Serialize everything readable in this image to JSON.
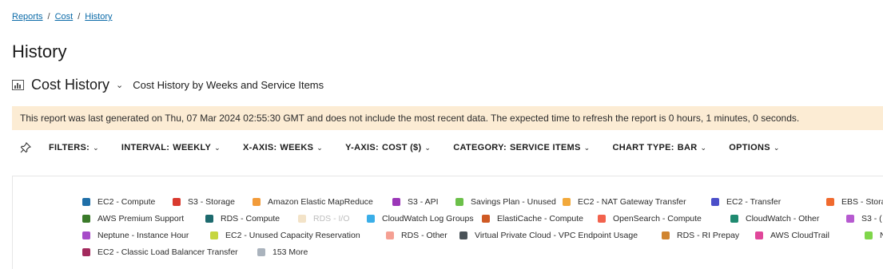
{
  "breadcrumb": {
    "items": [
      "Reports",
      "Cost",
      "History"
    ],
    "separator": "/"
  },
  "page": {
    "title": "History"
  },
  "report": {
    "icon": "bar-chart-icon",
    "name": "Cost History",
    "subtitle": "Cost History by Weeks and Service Items"
  },
  "banner": {
    "text": "This report was last generated on Thu, 07 Mar 2024 02:55:30 GMT and does not include the most recent data.  The expected time to refresh the report is 0 hours, 1 minutes, 0 seconds.",
    "background": "#fcecd4"
  },
  "filters": {
    "pin_icon": "pin-icon",
    "items": [
      {
        "label": "FILTERS:",
        "value": ""
      },
      {
        "label": "INTERVAL:",
        "value": "WEEKLY"
      },
      {
        "label": "X-AXIS:",
        "value": "WEEKS"
      },
      {
        "label": "Y-AXIS:",
        "value": "COST ($)"
      },
      {
        "label": "CATEGORY:",
        "value": "SERVICE ITEMS"
      },
      {
        "label": "CHART TYPE:",
        "value": "BAR"
      },
      {
        "label": "OPTIONS",
        "value": ""
      }
    ]
  },
  "legend": {
    "rows": [
      [
        {
          "label": "EC2 - Compute",
          "color": "#1f6fa8"
        },
        {
          "label": "S3 - Storage",
          "color": "#d93a2f"
        },
        {
          "label": "Amazon Elastic MapReduce",
          "color": "#f29b3a"
        },
        {
          "label": "S3 - API",
          "color": "#9b37b8"
        },
        {
          "label": "Savings Plan - Unused",
          "color": "#6cc04a"
        },
        {
          "label": "EC2 - NAT Gateway Transfer",
          "color": "#f2a93b"
        },
        {
          "label": "EC2 - Transfer",
          "color": "#4b4fc9"
        },
        {
          "label": "EBS - Storage",
          "color": "#f06a2e"
        }
      ],
      [
        {
          "label": "AWS Premium Support",
          "color": "#3a7a2a"
        },
        {
          "label": "RDS - Compute",
          "color": "#1d6a6e"
        },
        {
          "label": "RDS - I/O",
          "color": "#f3e3c8",
          "dim": true
        },
        {
          "label": "CloudWatch Log Groups",
          "color": "#3aaee8"
        },
        {
          "label": "ElastiCache - Compute",
          "color": "#cf5a25"
        },
        {
          "label": "OpenSearch - Compute",
          "color": "#f2624d"
        },
        {
          "label": "CloudWatch - Other",
          "color": "#1f8a70"
        },
        {
          "label": "S3 - (",
          "color": "#b65ad0"
        }
      ],
      [
        {
          "label": "Neptune - Instance Hour",
          "color": "#a64bc8"
        },
        {
          "label": "EC2 - Unused Capacity Reservation",
          "color": "#c6d63f"
        },
        {
          "label": "RDS - Other",
          "color": "#f5a093"
        },
        {
          "label": "Virtual Private Cloud - VPC Endpoint Usage",
          "color": "#4a5258"
        },
        {
          "label": "RDS - RI Prepay",
          "color": "#d08430"
        },
        {
          "label": "AWS CloudTrail",
          "color": "#e0479a"
        },
        {
          "label": "Nept",
          "color": "#7fd64a"
        }
      ],
      [
        {
          "label": "EC2 - Classic Load Balancer Transfer",
          "color": "#a32a5e"
        },
        {
          "label": "153 More",
          "color": "#aab3bd"
        }
      ]
    ]
  }
}
